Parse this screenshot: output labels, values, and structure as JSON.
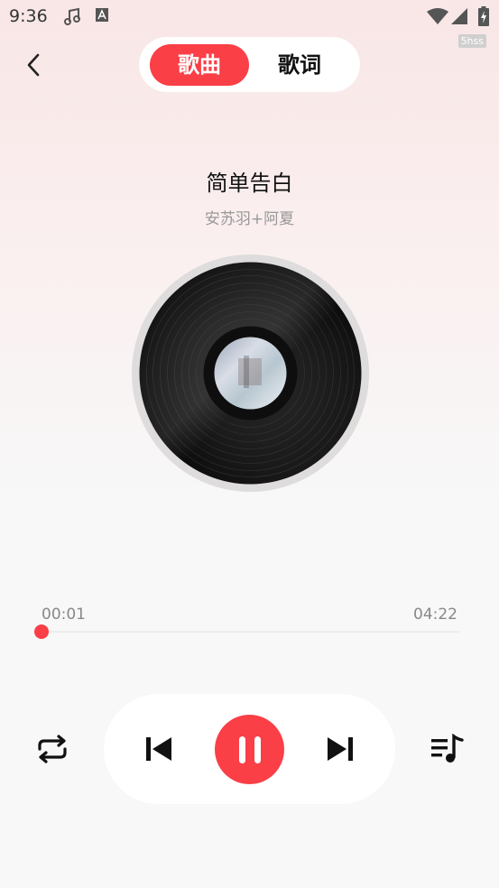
{
  "status_bar": {
    "time": "9:36",
    "badge": "5hss",
    "icons": [
      "music-note-icon",
      "a-letter-icon",
      "wifi-icon",
      "signal-icon",
      "battery-charging-icon"
    ]
  },
  "header": {
    "back_icon": "back-arrow-icon",
    "tabs": [
      {
        "label": "歌曲",
        "active": true
      },
      {
        "label": "歌词",
        "active": false
      }
    ]
  },
  "song": {
    "title": "简单告白",
    "artist": "安苏羽+阿夏"
  },
  "progress": {
    "current": "00:01",
    "total": "04:22",
    "fraction": 0.004
  },
  "controls": {
    "repeat_icon": "repeat-icon",
    "previous_icon": "skip-previous-icon",
    "play_state_icon": "pause-icon",
    "next_icon": "skip-next-icon",
    "playlist_icon": "playlist-icon"
  },
  "colors": {
    "accent": "#fa3f47",
    "background_top": "#f9e6e6",
    "background_bottom": "#f8f8f8"
  }
}
